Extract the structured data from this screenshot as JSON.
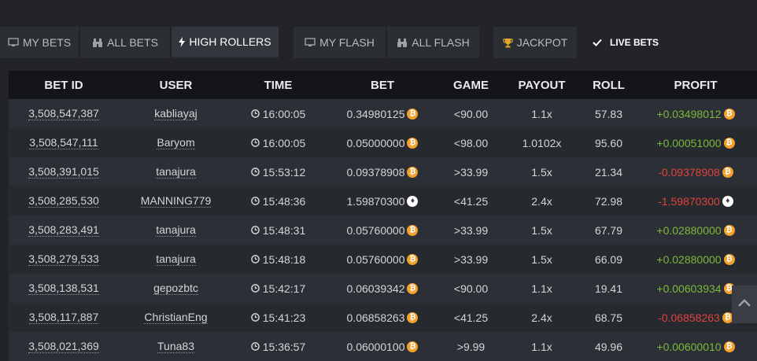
{
  "tabs": [
    {
      "label": "MY BETS",
      "icon": "monitor-icon"
    },
    {
      "label": "ALL BETS",
      "icon": "binoculars-icon"
    },
    {
      "label": "HIGH ROLLERS",
      "icon": "bolt-icon",
      "active": true
    },
    {
      "label": "MY FLASH",
      "icon": "monitor-icon"
    },
    {
      "label": "ALL FLASH",
      "icon": "binoculars-icon"
    },
    {
      "label": "JACKPOT",
      "icon": "trophy-icon"
    },
    {
      "label": "LIVE BETS",
      "icon": "checkmark-icon"
    }
  ],
  "columns": [
    "BET ID",
    "USER",
    "TIME",
    "BET",
    "GAME",
    "PAYOUT",
    "ROLL",
    "PROFIT"
  ],
  "rows": [
    {
      "bet_id": "3,508,547,387",
      "user": "kabliayaj",
      "time": "16:00:05",
      "bet": "0.34980125",
      "currency": "btc",
      "game": "<90.00",
      "payout": "1.1x",
      "roll": "57.83",
      "profit": "+0.03498012"
    },
    {
      "bet_id": "3,508,547,111",
      "user": "Baryom",
      "time": "16:00:05",
      "bet": "0.05000000",
      "currency": "btc",
      "game": "<98.00",
      "payout": "1.0102x",
      "roll": "95.60",
      "profit": "+0.00051000"
    },
    {
      "bet_id": "3,508,391,015",
      "user": "tanajura",
      "time": "15:53:12",
      "bet": "0.09378908",
      "currency": "btc",
      "game": ">33.99",
      "payout": "1.5x",
      "roll": "21.34",
      "profit": "-0.09378908"
    },
    {
      "bet_id": "3,508,285,530",
      "user": "MANNING779",
      "time": "15:48:36",
      "bet": "1.59870300",
      "currency": "eth",
      "game": "<41.25",
      "payout": "2.4x",
      "roll": "72.98",
      "profit": "-1.59870300"
    },
    {
      "bet_id": "3,508,283,491",
      "user": "tanajura",
      "time": "15:48:31",
      "bet": "0.05760000",
      "currency": "btc",
      "game": ">33.99",
      "payout": "1.5x",
      "roll": "67.79",
      "profit": "+0.02880000"
    },
    {
      "bet_id": "3,508,279,533",
      "user": "tanajura",
      "time": "15:48:18",
      "bet": "0.05760000",
      "currency": "btc",
      "game": ">33.99",
      "payout": "1.5x",
      "roll": "66.09",
      "profit": "+0.02880000"
    },
    {
      "bet_id": "3,508,138,531",
      "user": "gepozbtc",
      "time": "15:42:17",
      "bet": "0.06039342",
      "currency": "btc",
      "game": "<90.00",
      "payout": "1.1x",
      "roll": "19.41",
      "profit": "+0.00603934"
    },
    {
      "bet_id": "3,508,117,887",
      "user": "ChristianEng",
      "time": "15:41:23",
      "bet": "0.06858263",
      "currency": "btc",
      "game": "<41.25",
      "payout": "2.4x",
      "roll": "68.75",
      "profit": "-0.06858263"
    },
    {
      "bet_id": "3,508,021,369",
      "user": "Tuna83",
      "time": "15:36:57",
      "bet": "0.06000100",
      "currency": "btc",
      "game": ">9.99",
      "payout": "1.1x",
      "roll": "49.96",
      "profit": "+0.00600010"
    }
  ],
  "colors": {
    "background": "#222429",
    "header": "#141518",
    "positive": "#7ab93a",
    "negative": "#e0433c",
    "btc": "#f2a12b"
  }
}
